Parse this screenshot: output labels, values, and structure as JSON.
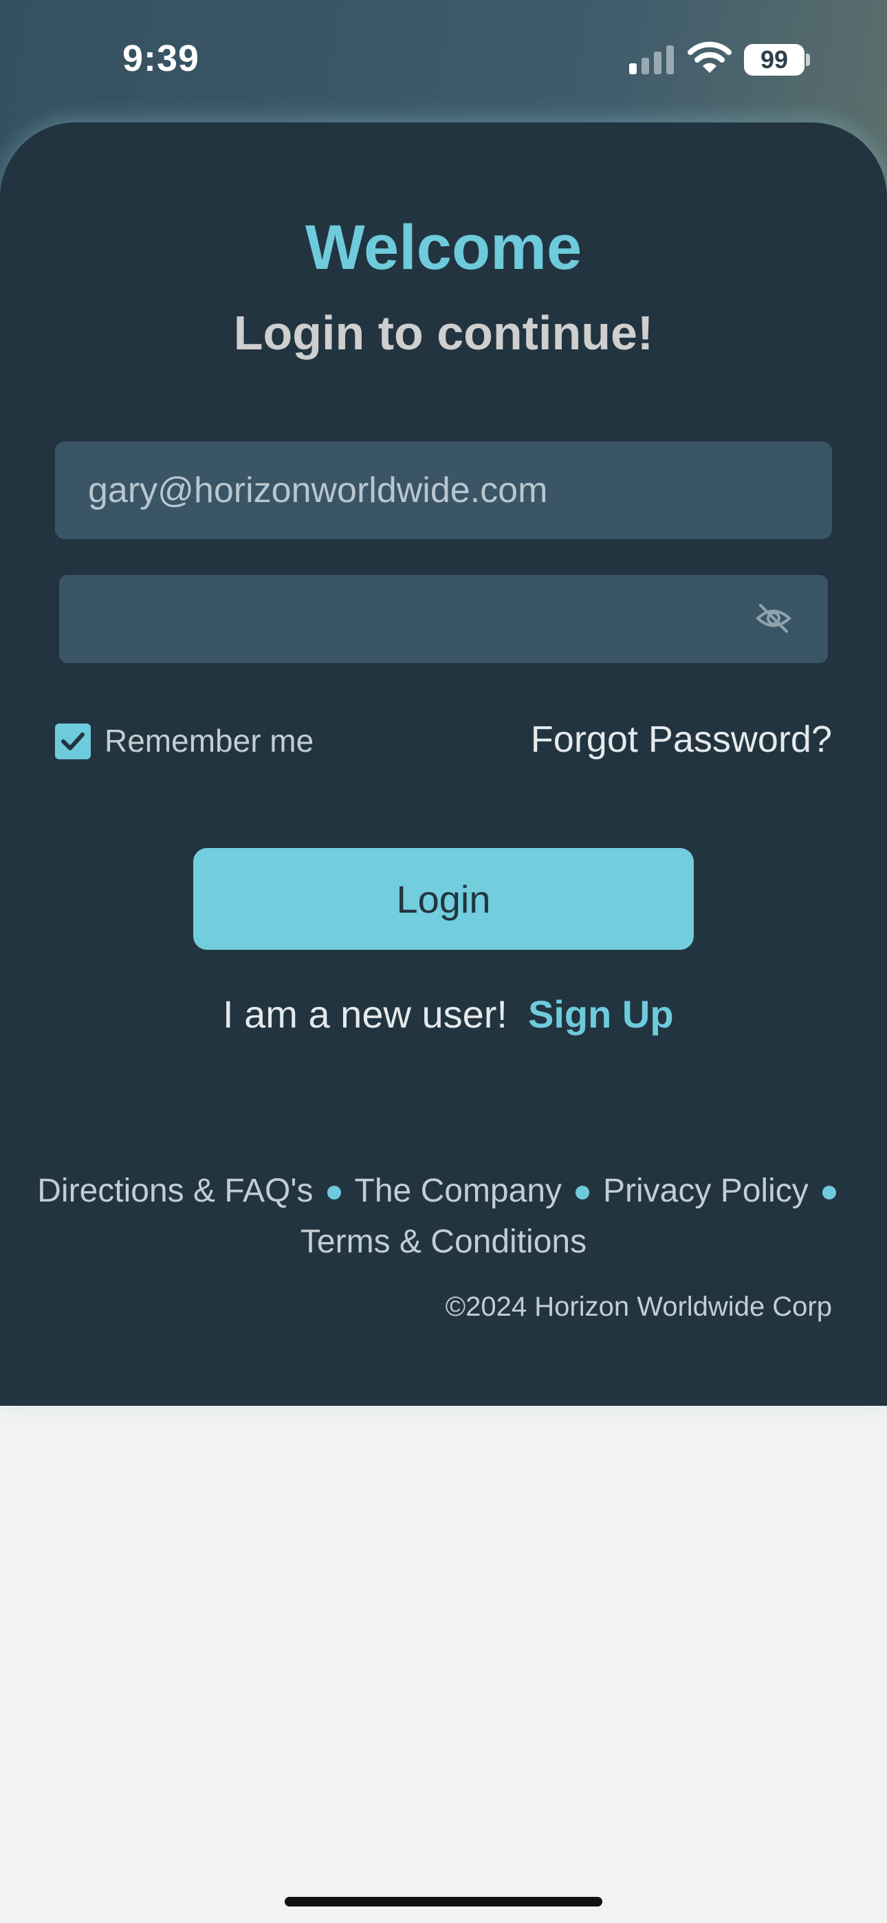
{
  "status_bar": {
    "time": "9:39",
    "battery": "99",
    "icons": [
      "signal-icon",
      "wifi-icon",
      "battery-icon"
    ]
  },
  "login": {
    "welcome": "Welcome",
    "subtitle": "Login to continue!",
    "email_value": "gary@horizonworldwide.com",
    "password_value": "",
    "remember_label": "Remember me",
    "remember_checked": true,
    "forgot_password": "Forgot Password?",
    "login_button": "Login",
    "new_user_text": "I am a new user!",
    "signup_link": "Sign Up"
  },
  "footer": {
    "links": [
      "Directions & FAQ's",
      "The Company",
      "Privacy Policy",
      "Terms & Conditions"
    ],
    "copyright": "©2024 Horizon Worldwide Corp"
  },
  "colors": {
    "accent": "#6ecbdc",
    "card_background": "#223440",
    "input_background": "#3a5566",
    "page_background": "#f2f2f2"
  }
}
